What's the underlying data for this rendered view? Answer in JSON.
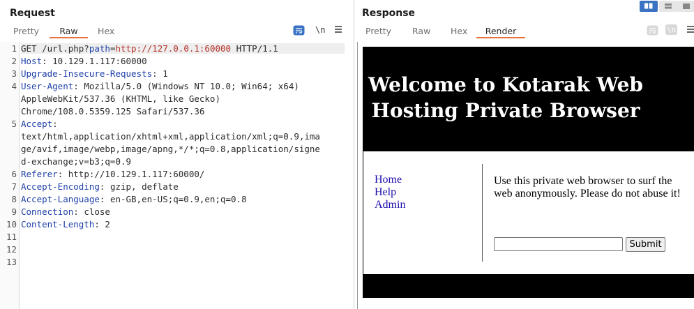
{
  "request": {
    "title": "Request",
    "tabs": [
      "Pretty",
      "Raw",
      "Hex"
    ],
    "active_tab": "Raw",
    "tools": {
      "wrap_icon": "wrap-lines-icon",
      "newline_label": "\\n",
      "menu_icon": "hamburger-menu-icon"
    },
    "line_numbers": [
      "1",
      "2",
      "3",
      "4",
      "5",
      "6",
      "7",
      "8",
      "9",
      "10",
      "11",
      "12",
      "13"
    ],
    "lines": {
      "l1_method": "GET /url.php?",
      "l1_param": "path",
      "l1_eq": "=",
      "l1_val": "http://127.0.0.1:60000",
      "l1_proto": " HTTP/1.1",
      "l2_name": "Host",
      "l2_val": ": 10.129.1.117:60000",
      "l3_name": "Upgrade-Insecure-Requests",
      "l3_val": ": 1",
      "l4_name": "User-Agent",
      "l4_val": ": Mozilla/5.0 (Windows NT 10.0; Win64; x64)",
      "l4_cont1": "AppleWebKit/537.36 (KHTML, like Gecko)",
      "l4_cont2": "Chrome/108.0.5359.125 Safari/537.36",
      "l5_name": "Accept",
      "l5_val": ":",
      "l5_cont1": "text/html,application/xhtml+xml,application/xml;q=0.9,ima",
      "l5_cont2": "ge/avif,image/webp,image/apng,*/*;q=0.8,application/signe",
      "l5_cont3": "d-exchange;v=b3;q=0.9",
      "l6_name": "Referer",
      "l6_val": ": http://10.129.1.117:60000/",
      "l7_name": "Accept-Encoding",
      "l7_val": ": gzip, deflate",
      "l8_name": "Accept-Language",
      "l8_val": ": en-GB,en-US;q=0.9,en;q=0.8",
      "l9_name": "Connection",
      "l9_val": ": close",
      "l10_name": "Content-Length",
      "l10_val": ": 2"
    }
  },
  "response": {
    "title": "Response",
    "tabs": [
      "Pretty",
      "Raw",
      "Hex",
      "Render"
    ],
    "active_tab": "Render",
    "tools": {
      "wrap_icon": "wrap-lines-icon",
      "newline_label": "\\n",
      "menu_icon": "hamburger-menu-icon"
    },
    "layout_buttons": [
      "split-vertical-icon",
      "split-horizontal-icon",
      "single-pane-icon"
    ],
    "render": {
      "heading": "Welcome to Kotarak Web Hosting Private Browser",
      "nav": [
        "Home",
        "Help",
        "Admin"
      ],
      "description": "Use this private web browser to surf the web anonymously. Please do not abuse it!",
      "url_input_value": "",
      "submit_label": "Submit"
    }
  },
  "colors": {
    "accent_tab_underline": "#e8703a",
    "header_name": "#1d3fa8",
    "param_value": "#b5322a",
    "layout_active": "#3b73c4"
  }
}
